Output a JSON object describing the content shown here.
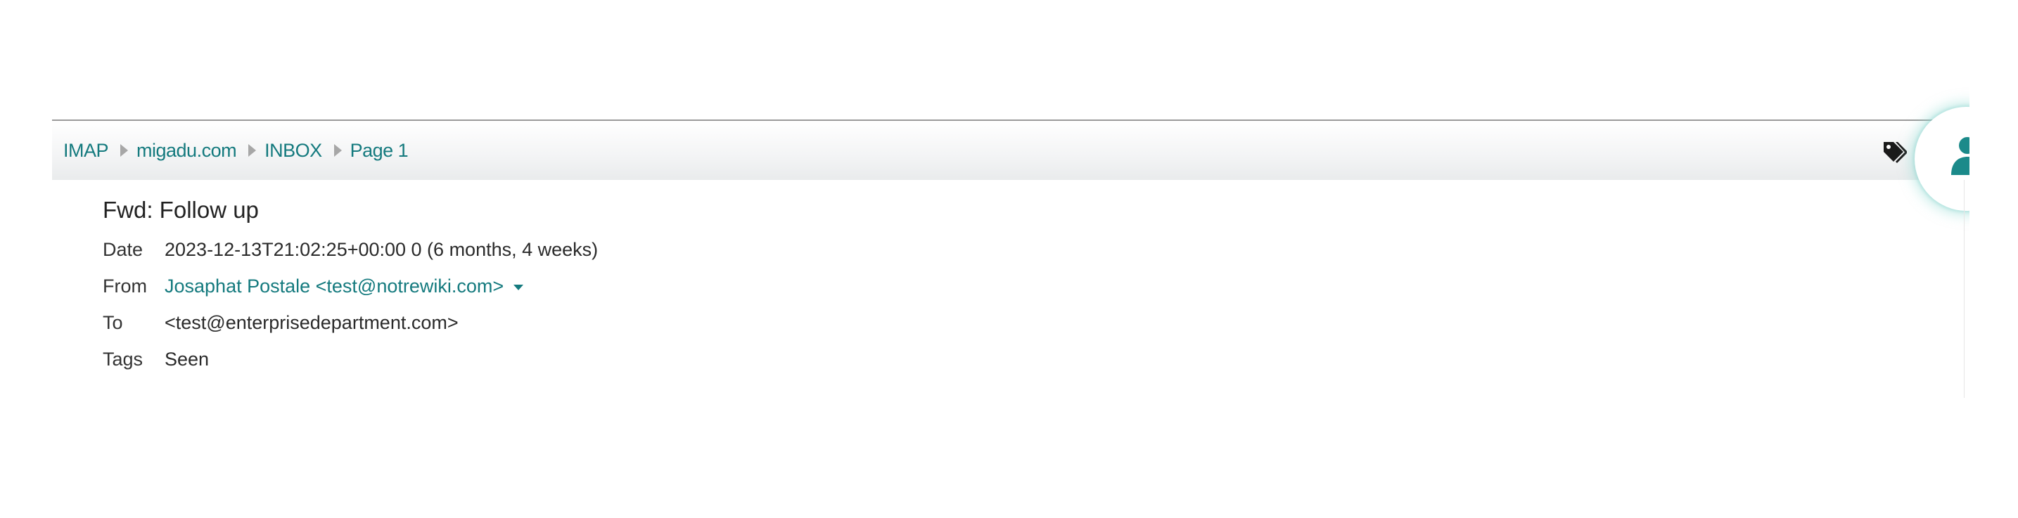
{
  "breadcrumb": {
    "items": [
      "IMAP",
      "migadu.com",
      "INBOX",
      "Page 1"
    ]
  },
  "toolbar": {
    "tag_icon": "tag-icon",
    "add_contact_icon": "add-contact-icon"
  },
  "message": {
    "subject": "Fwd: Follow up",
    "date_label": "Date",
    "date_value": "2023-12-13T21:02:25+00:00 0 (6 months, 4 weeks)",
    "from_label": "From",
    "from_value": "Josaphat Postale <test@notrewiki.com>",
    "to_label": "To",
    "to_value": "<test@enterprisedepartment.com>",
    "tags_label": "Tags",
    "tags_value": "Seen"
  },
  "colors": {
    "link": "#147a7e",
    "accent": "#1b8a8a",
    "text": "#333333"
  }
}
